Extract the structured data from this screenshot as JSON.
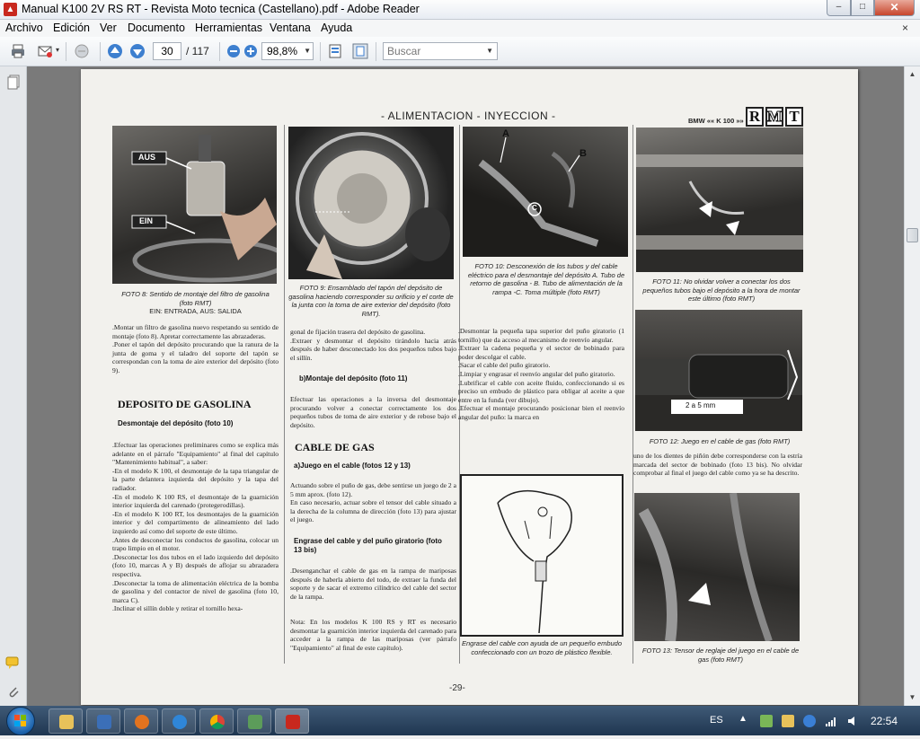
{
  "window": {
    "title": "Manual K100 2V RS RT - Revista Moto tecnica (Castellano).pdf - Adobe Reader",
    "minimize": "–",
    "maximize": "□",
    "close": "✕"
  },
  "menu": {
    "items": [
      "Archivo",
      "Edición",
      "Ver",
      "Documento",
      "Herramientas",
      "Ventana",
      "Ayuda"
    ],
    "close_document": "×"
  },
  "toolbar": {
    "current_page": "30",
    "total_pages": "/ 117",
    "zoom": "98,8%",
    "search_placeholder": "Buscar"
  },
  "document": {
    "header": "- ALIMENTACION - INYECCION -",
    "series_label": "BMW «« K 100 »»",
    "logo_letters": [
      "R",
      "M",
      "T"
    ],
    "page_number": "-29-",
    "photo_labels": {
      "aus": "AUS",
      "ein": "EIN",
      "a": "A",
      "b": "B",
      "c": "C",
      "gap": "2 a 5 mm"
    },
    "captions": {
      "foto8": "FOTO 8: Sentido de montaje del filtro de gasolina (foto RMT)",
      "foto8_note": "EIN: ENTRADA, AUS: SALIDA",
      "foto9": "FOTO 9: Ensamblado del tapón del depósito de gasolina haciendo corresponder su orificio y el corte de la junta con la toma de aire exterior del depósito (foto RMT).",
      "foto10": "FOTO 10: Desconexión de los tubos y del cable eléctrico para el desmontaje del depósito A. Tubo de retorno de gasolina - B. Tubo de alimentación de la rampa -C. Toma múltiple (foto RMT)",
      "foto11": "FOTO 11: No olvidar volver a conectar los dos pequeños tubos bajo el depósito a la hora de montar este último (foto RMT)",
      "foto12": "FOTO 12: Juego en el cable de gas (foto RMT)",
      "foto13": "FOTO 13: Tensor de reglaje del juego en el cable de gas (foto RMT)",
      "drawing": "Engrase del cable con ayuda de un pequeño embudo confeccionado con un trozo de plástico flexible."
    },
    "col1": {
      "intro": ".Montar un filtro de gasolina nuevo respetando su sentido de montaje (foto 8). Apretar correctamente las abrazaderas.\n.Poner el tapón del depósito procurando que la ranura de la junta de goma y el taladro del soporte del tapón se correspondan con la toma de aire exterior del depósito (foto 9).",
      "section": "DEPOSITO DE GASOLINA",
      "subhead": "Desmontaje del depósito (foto 10)",
      "body": ".Efectuar las operaciones preliminares como se explica más adelante en el párrafo \"Equipamiento\" al final del capítulo \"Mantenimiento habitual\", a saber:\n-En el modelo K 100, el desmontaje de la tapa triangular de la parte delantera izquierda del depósito y la tapa del radiador.\n-En el modelo K 100 RS, el desmontaje de la guarnición interior izquierda del carenado (protegerodillas).\n-En el modelo K 100 RT, los desmontajes de la guarnición interior y del compartimento de alineamiento del lado izquierdo así como del soporte de este último.\n.Antes de desconectar los conductos de gasolina, colocar un trapo limpio en el motor.\n.Desconectar los dos tubos en el lado izquierdo del depósito (foto 10, marcas A y B) después de aflojar su abrazadera respectiva.\n.Desconectar la toma de alimentación eléctrica de la bomba de gasolina y del contactor de nivel de gasolina (foto 10, marca C).\n.Inclinar el sillín doble y retirar el tornillo hexa-"
    },
    "col2": {
      "intro": "gonal de fijación trasera del depósito de gasolina.\n.Extraer y desmontar el depósito tirándolo hacia atrás después de haber desconectado los dos pequeños tubos bajo el sillín.",
      "subhead1": "b)Montaje del depósito (foto 11)",
      "body1": "Efectuar las operaciones a la inversa del desmontaje procurando volver a conectar correctamente los dos pequeños tubos de toma de aire exterior y de rebose bajo el depósito.",
      "section": "CABLE DE GAS",
      "subhead2": "a)Juego en el cable (fotos 12 y 13)",
      "body2": "Actuando sobre el puño de gas, debe sentirse un juego de 2 a 5 mm aprox. (foto 12).\nEn caso necesario, actuar sobre el tensor del cable situado a la derecha de la columna de dirección (foto 13) para ajustar el juego.",
      "subhead3": "Engrase del cable y del puño giratorio (foto 13 bis)",
      "body3": ".Desenganchar el cable de gas en la rampa de mariposas después de haberla abierto del todo, de extraer la funda del soporte y de sacar el extremo cilíndrico del cable del sector de la rampa.",
      "note": "Nota: En los modelos K 100 RS y RT es necesario desmontar la guarnición interior izquierda del carenado para acceder a la rampa de las mariposas (ver párrafo \"Equipamiento\" al final de este capítulo)."
    },
    "col3": {
      "body": ".Desmontar la pequeña tapa superior del puño giratorio (1 tornillo) que da acceso al mecanismo de reenvío angular.\n.Extraer la cadena pequeña y el sector de bobinado para poder descolgar el cable.\n.Sacar el cable del puño giratorio.\n.Limpiar y engrasar el reenvío angular del puño giratorio.\n.Lubrificar el cable con aceite fluido, confeccionando si es preciso un embudo de plástico para obligar al aceite a que entre en la funda (ver dibujo).\n.Efectuar el montaje procurando posicionar bien el reenvío angular del puño: la marca en"
    },
    "col4": {
      "body": "uno de los dientes de piñón debe corresponderse con la estría marcada del sector de bobinado (foto 13 bis). No olvidar comprobar al final el juego del cable como ya se ha descrito."
    }
  },
  "taskbar": {
    "language": "ES",
    "chevron": "▲",
    "time": "22:54"
  }
}
